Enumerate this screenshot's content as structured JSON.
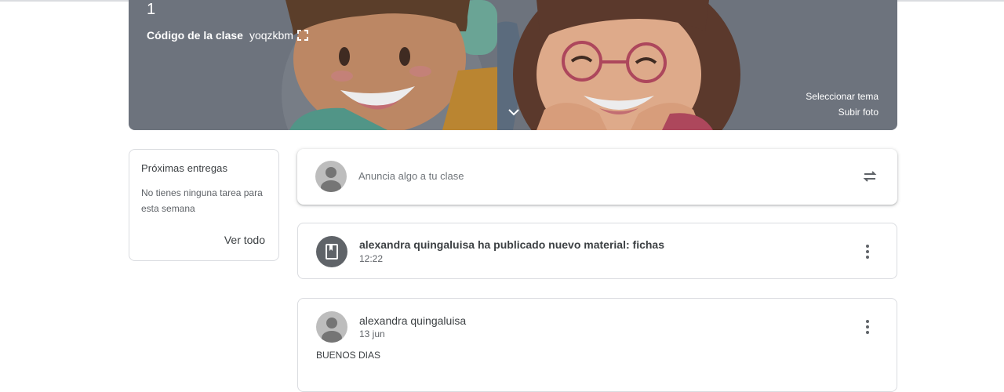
{
  "banner": {
    "class_number": "1",
    "code_label": "Código de la clase",
    "code_value": "yoqzkbm",
    "select_theme": "Seleccionar tema",
    "upload_photo": "Subir foto"
  },
  "upcoming": {
    "title": "Próximas entregas",
    "message": "No tienes ninguna tarea para esta semana",
    "see_all": "Ver todo"
  },
  "announce": {
    "placeholder": "Anuncia algo a tu clase"
  },
  "stream": [
    {
      "title": "alexandra quingaluisa ha publicado nuevo material: fichas",
      "time": "12:22",
      "icon": "book-icon"
    },
    {
      "title": "alexandra quingaluisa",
      "time": "13 jun",
      "body": "BUENOS DIAS",
      "icon": "avatar"
    }
  ],
  "icons": [
    "expand-icon",
    "chevron-down-icon",
    "repost-icon",
    "more-vert-icon",
    "book-icon",
    "avatar-icon"
  ],
  "colors": {
    "banner": "#6f7680",
    "border": "#dadce0",
    "text": "#3c4043",
    "muted": "#5f6368"
  }
}
